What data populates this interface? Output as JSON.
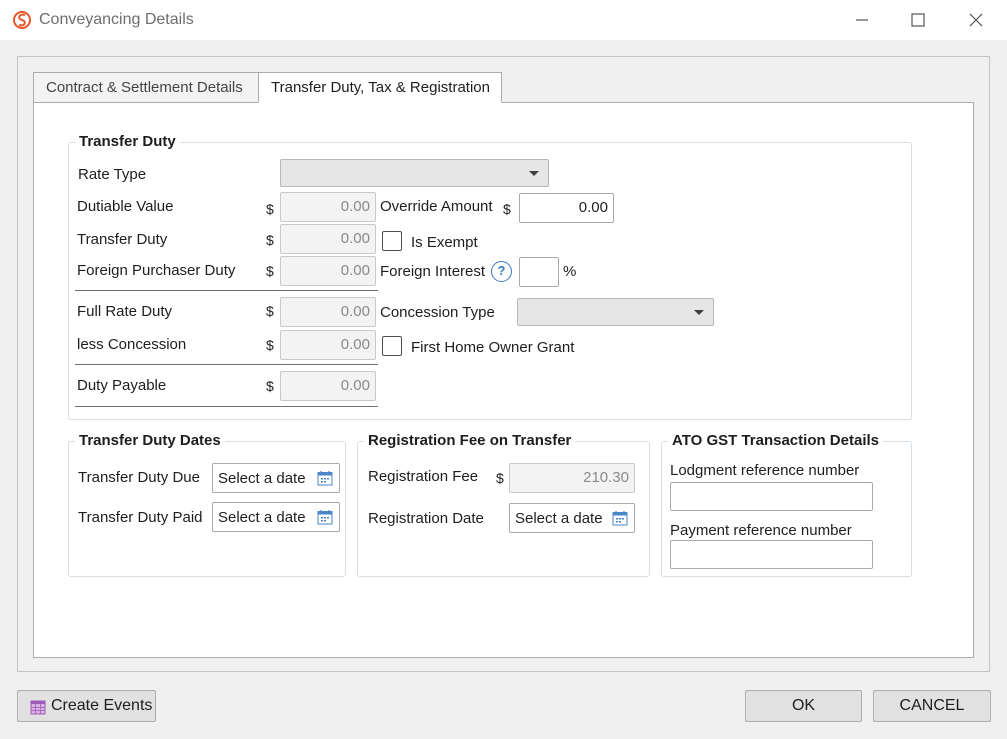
{
  "window": {
    "title": "Conveyancing Details",
    "logo_icon": "app-logo-icon",
    "accent": "#e8572a"
  },
  "tabs": [
    {
      "label": "Contract & Settlement Details",
      "active": false
    },
    {
      "label": "Transfer Duty, Tax & Registration",
      "active": true
    }
  ],
  "transfer_duty": {
    "title": "Transfer Duty",
    "rate_type_label": "Rate Type",
    "rate_type_value": "",
    "dutiable_value_label": "Dutiable Value",
    "dutiable_value": "0.00",
    "transfer_duty_label": "Transfer Duty",
    "transfer_duty_value": "0.00",
    "foreign_purchaser_label": "Foreign Purchaser Duty",
    "foreign_purchaser_value": "0.00",
    "full_rate_label": "Full Rate Duty",
    "full_rate_value": "0.00",
    "less_concession_label": "less Concession",
    "less_concession_value": "0.00",
    "duty_payable_label": "Duty Payable",
    "duty_payable_value": "0.00",
    "override_label": "Override Amount",
    "override_value": "0.00",
    "is_exempt_label": "Is Exempt",
    "is_exempt_checked": false,
    "foreign_interest_label": "Foreign Interest",
    "foreign_interest_value": "",
    "percent": "%",
    "concession_type_label": "Concession Type",
    "concession_type_value": "",
    "first_home_label": "First Home Owner Grant",
    "first_home_checked": false,
    "currency": "$",
    "help_glyph": "?"
  },
  "duty_dates": {
    "title": "Transfer Duty Dates",
    "due_label": "Transfer Duty Due",
    "paid_label": "Transfer Duty Paid",
    "placeholder": "Select a date"
  },
  "registration": {
    "title": "Registration Fee on Transfer",
    "fee_label": "Registration Fee",
    "fee_value": "210.30",
    "date_label": "Registration Date",
    "placeholder": "Select a date",
    "currency": "$"
  },
  "ato": {
    "title": "ATO GST Transaction Details",
    "lodgment_label": "Lodgment reference number",
    "lodgment_value": "",
    "payment_label": "Payment reference number",
    "payment_value": ""
  },
  "footer": {
    "create_events": "Create Events",
    "ok": "OK",
    "cancel": "CANCEL"
  }
}
